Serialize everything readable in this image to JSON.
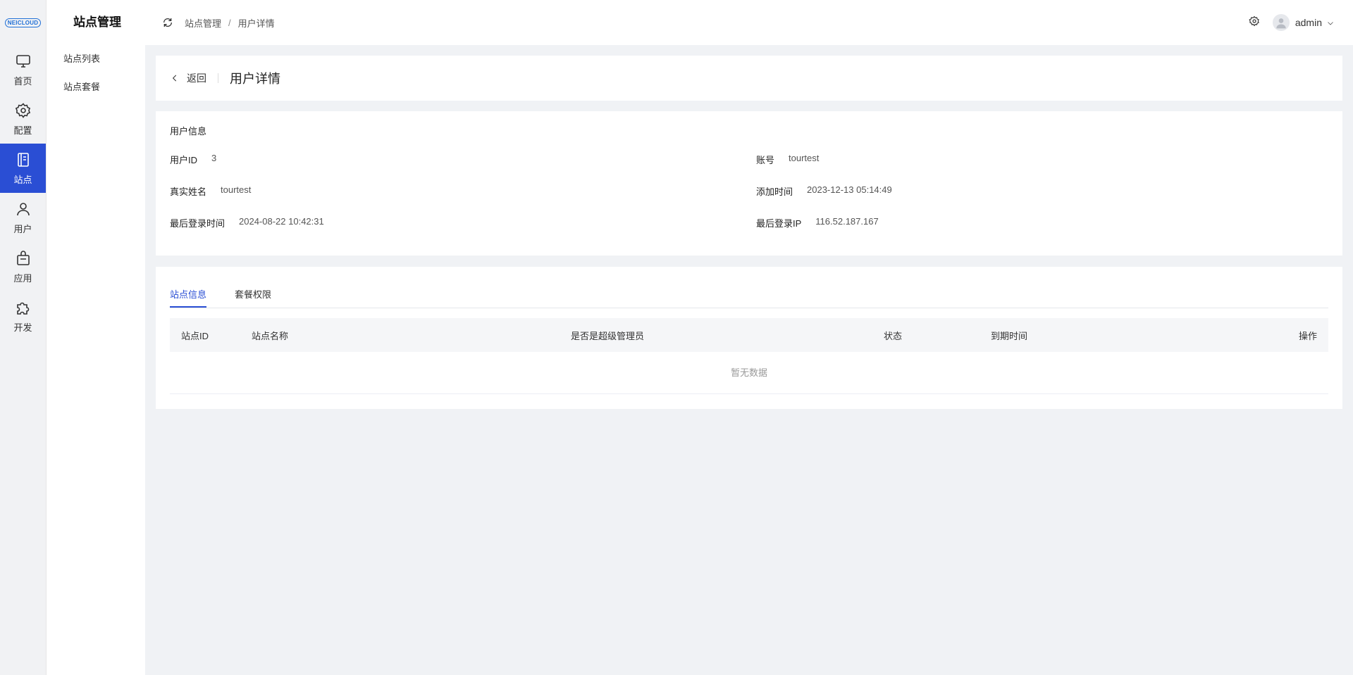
{
  "brand": {
    "logo_text": "NEICLOUD"
  },
  "rail": [
    {
      "name": "rail-item-home",
      "icon": "monitor-icon",
      "label": "首页"
    },
    {
      "name": "rail-item-config",
      "icon": "gear-icon",
      "label": "配置"
    },
    {
      "name": "rail-item-sites",
      "icon": "book-icon",
      "label": "站点"
    },
    {
      "name": "rail-item-users",
      "icon": "user-icon",
      "label": "用户"
    },
    {
      "name": "rail-item-apps",
      "icon": "bag-icon",
      "label": "应用"
    },
    {
      "name": "rail-item-dev",
      "icon": "puzzle-icon",
      "label": "开发"
    }
  ],
  "subnav": {
    "title": "站点管理",
    "items": [
      "站点列表",
      "站点套餐"
    ]
  },
  "header": {
    "breadcrumb": [
      "站点管理",
      "用户详情"
    ],
    "breadcrumb_sep": "/",
    "username": "admin"
  },
  "page": {
    "back_label": "返回",
    "title": "用户详情"
  },
  "user_info": {
    "section_title": "用户信息",
    "fields": [
      {
        "label": "用户ID",
        "value": "3"
      },
      {
        "label": "账号",
        "value": "tourtest"
      },
      {
        "label": "真实姓名",
        "value": "tourtest"
      },
      {
        "label": "添加时间",
        "value": "2023-12-13 05:14:49"
      },
      {
        "label": "最后登录时间",
        "value": "2024-08-22 10:42:31"
      },
      {
        "label": "最后登录IP",
        "value": "116.52.187.167"
      }
    ]
  },
  "tabs": [
    "站点信息",
    "套餐权限"
  ],
  "table": {
    "columns": [
      "站点ID",
      "站点名称",
      "是否是超级管理员",
      "状态",
      "到期时间",
      "操作"
    ],
    "empty_text": "暂无数据"
  },
  "colors": {
    "accent": "#2a4ed4"
  }
}
